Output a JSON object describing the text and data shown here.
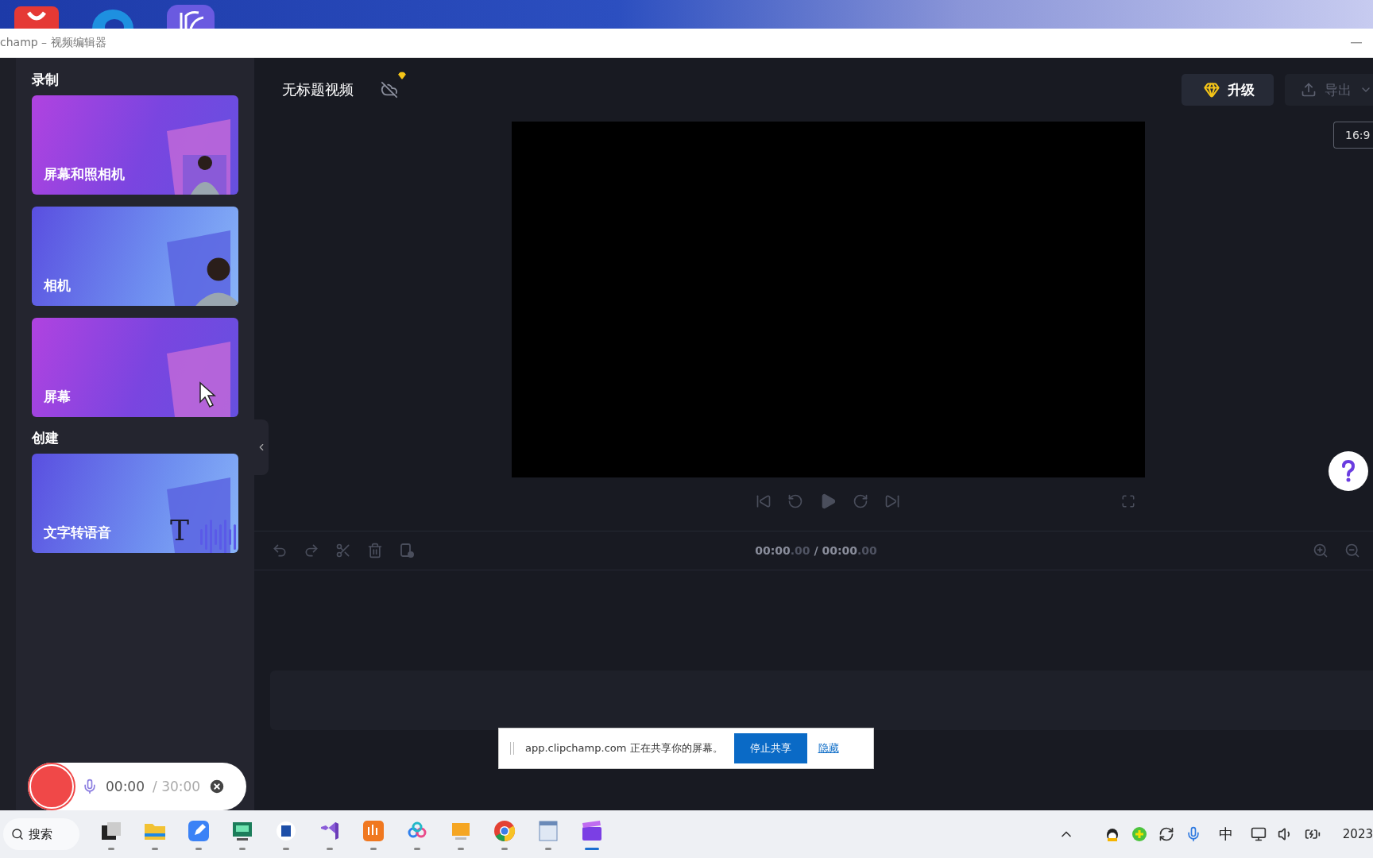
{
  "window": {
    "title": "champ – 视频编辑器"
  },
  "panel": {
    "sections": [
      {
        "heading": "录制",
        "cards": [
          {
            "label": "屏幕和照相机",
            "kind": "screen-camera"
          },
          {
            "label": "相机",
            "kind": "camera"
          },
          {
            "label": "屏幕",
            "kind": "screen"
          }
        ]
      },
      {
        "heading": "创建",
        "cards": [
          {
            "label": "文字转语音",
            "kind": "tts",
            "glyph": "T"
          }
        ]
      }
    ]
  },
  "project": {
    "title": "无标题视频"
  },
  "header": {
    "upgrade": "升级",
    "export": "导出",
    "aspect": "16:9"
  },
  "timecode": {
    "current": "00:00",
    "current_frac": ".00",
    "separator": "/",
    "total": "00:00",
    "total_frac": ".00"
  },
  "share_bar": {
    "message": "app.clipchamp.com 正在共享你的屏幕。",
    "stop": "停止共享",
    "hide": "隐藏"
  },
  "recorder": {
    "elapsed": "00:00",
    "limit": "/ 30:00"
  },
  "taskbar": {
    "search": "搜索",
    "apps": [
      {
        "kind": "taskview",
        "selected": false
      },
      {
        "kind": "folder",
        "selected": false
      },
      {
        "kind": "notes",
        "selected": false
      },
      {
        "kind": "android",
        "selected": false
      },
      {
        "kind": "word",
        "selected": false
      },
      {
        "kind": "vs",
        "selected": false
      },
      {
        "kind": "audio",
        "selected": false
      },
      {
        "kind": "cloud",
        "selected": false
      },
      {
        "kind": "slides",
        "selected": false
      },
      {
        "kind": "chrome",
        "selected": false
      },
      {
        "kind": "editor",
        "selected": false
      },
      {
        "kind": "clipchamp",
        "selected": true
      }
    ],
    "ime": "中",
    "clock": "2023"
  }
}
